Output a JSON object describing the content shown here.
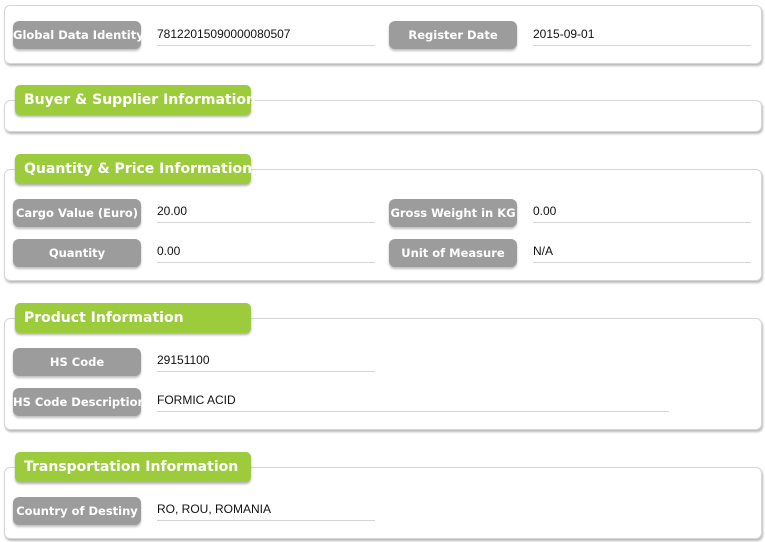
{
  "header": {
    "fields": [
      {
        "label": "Global Data Identity",
        "value": "78122015090000080507"
      },
      {
        "label": "Register Date",
        "value": "2015-09-01"
      }
    ]
  },
  "sections": {
    "buyer_supplier": {
      "title": "Buyer & Supplier Information"
    },
    "quantity_price": {
      "title": "Quantity & Price Information",
      "fields": [
        {
          "label": "Cargo Value (Euro)",
          "value": "20.00"
        },
        {
          "label": "Gross Weight in KG",
          "value": "0.00"
        },
        {
          "label": "Quantity",
          "value": "0.00"
        },
        {
          "label": "Unit of Measure",
          "value": "N/A"
        }
      ]
    },
    "product": {
      "title": "Product Information",
      "fields": [
        {
          "label": "HS Code",
          "value": "29151100"
        },
        {
          "label": "HS Code Description",
          "value": "FORMIC ACID"
        }
      ]
    },
    "transportation": {
      "title": "Transportation Information",
      "fields": [
        {
          "label": "Country of Destiny",
          "value": "RO, ROU, ROMANIA"
        }
      ]
    }
  },
  "colors": {
    "section_title_bg": "#9ccc3c",
    "label_bg": "#9c9c9c"
  }
}
